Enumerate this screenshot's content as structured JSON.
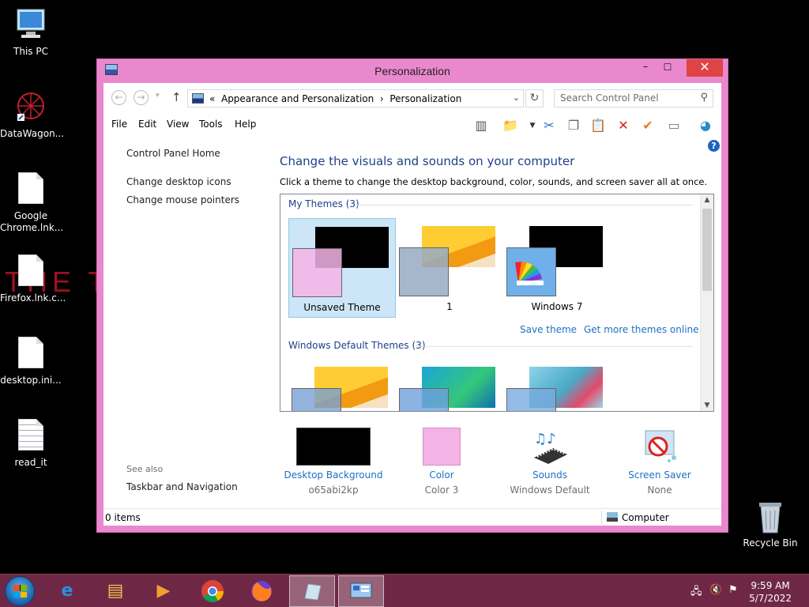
{
  "desktop": {
    "background_text": "THE TE",
    "icons": [
      {
        "label": "This PC"
      },
      {
        "label": "DataWagon..."
      },
      {
        "label": "Google Chrome.lnk..."
      },
      {
        "label": "Firefox.lnk.c..."
      },
      {
        "label": "desktop.ini..."
      },
      {
        "label": "read_it"
      },
      {
        "label": "Recycle Bin"
      }
    ]
  },
  "window": {
    "title": "Personalization",
    "controls": {
      "minimize": "–",
      "maximize": "☐",
      "close": "✕"
    },
    "address": {
      "prefix": "«",
      "crumb1": "Appearance and Personalization",
      "arrow": "›",
      "crumb2": "Personalization"
    },
    "search": {
      "placeholder": "Search Control Panel"
    },
    "menu": [
      "File",
      "Edit",
      "View",
      "Tools",
      "Help"
    ],
    "left_pane": {
      "home": "Control Panel Home",
      "links": [
        "Change desktop icons",
        "Change mouse pointers"
      ],
      "see_also_label": "See also",
      "see_also_links": [
        "Taskbar and Navigation"
      ]
    },
    "main": {
      "heading": "Change the visuals and sounds on your computer",
      "subheading": "Click a theme to change the desktop background, color, sounds, and screen saver all at once.",
      "my_themes_label": "My Themes (3)",
      "my_themes": [
        {
          "label": "Unsaved Theme",
          "selected": true,
          "wall_color": "#000000",
          "swatch_color": "#f4b3e6"
        },
        {
          "label": "1",
          "selected": false,
          "wall_color": "#f7b21c",
          "swatch_color": "#9aaec4"
        },
        {
          "label": "Windows 7",
          "selected": false,
          "wall_color": "#000000",
          "swatch_color": "#6fb0ea"
        }
      ],
      "save_theme": "Save theme",
      "get_more": "Get more themes online",
      "default_themes_label": "Windows Default Themes (3)"
    },
    "bottom": [
      {
        "link": "Desktop Background",
        "sub": "o65abi2kp"
      },
      {
        "link": "Color",
        "sub": "Color 3"
      },
      {
        "link": "Sounds",
        "sub": "Windows Default"
      },
      {
        "link": "Screen Saver",
        "sub": "None"
      }
    ],
    "status": {
      "items": "0 items",
      "location": "Computer"
    }
  },
  "taskbar": {
    "time": "9:59 AM",
    "date": "5/7/2022"
  },
  "colors": {
    "window_frame": "#ea88cd",
    "taskbar": "#6e2846",
    "link": "#1f6fc5",
    "heading": "#1e3f89"
  }
}
